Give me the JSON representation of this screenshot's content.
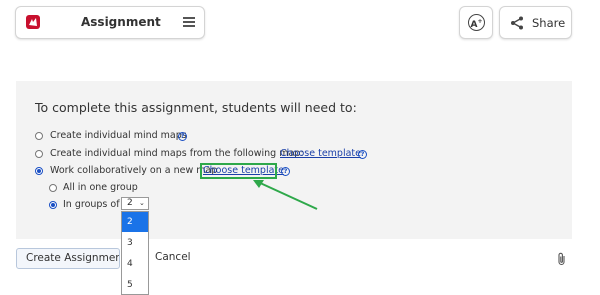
{
  "header": {
    "title": "Assignment",
    "accessibility_glyph": "A",
    "share_label": "Share"
  },
  "panel": {
    "heading": "To complete this assignment, students will need to:",
    "options": [
      {
        "label": "Create individual mind maps",
        "selected": false
      },
      {
        "label": "Create individual mind maps from the following map:",
        "link": "Choose template",
        "selected": false
      },
      {
        "label": "Work collaboratively on a new map",
        "link": "Choose template",
        "selected": true
      }
    ],
    "suboptions": [
      {
        "label": "All in one group",
        "selected": false
      },
      {
        "label": "In groups of",
        "selected": true
      }
    ],
    "group_size": {
      "value": "2",
      "options": [
        "2",
        "3",
        "4",
        "5"
      ],
      "highlighted": "2"
    },
    "help_glyph": "?"
  },
  "footer": {
    "create_label": "Create Assignment",
    "cancel_label": "Cancel"
  },
  "colors": {
    "brand": "#c8102e",
    "link": "#1a3fa8",
    "radio_accent": "#1a4fc4",
    "annotation": "#2ea84a",
    "dropdown_selected": "#1a73e8"
  },
  "icons": [
    "app-logo-icon",
    "hamburger-menu-icon",
    "accessibility-icon",
    "share-icon",
    "help-icon",
    "chevron-down-icon",
    "paperclip-icon",
    "annotation-arrow"
  ]
}
